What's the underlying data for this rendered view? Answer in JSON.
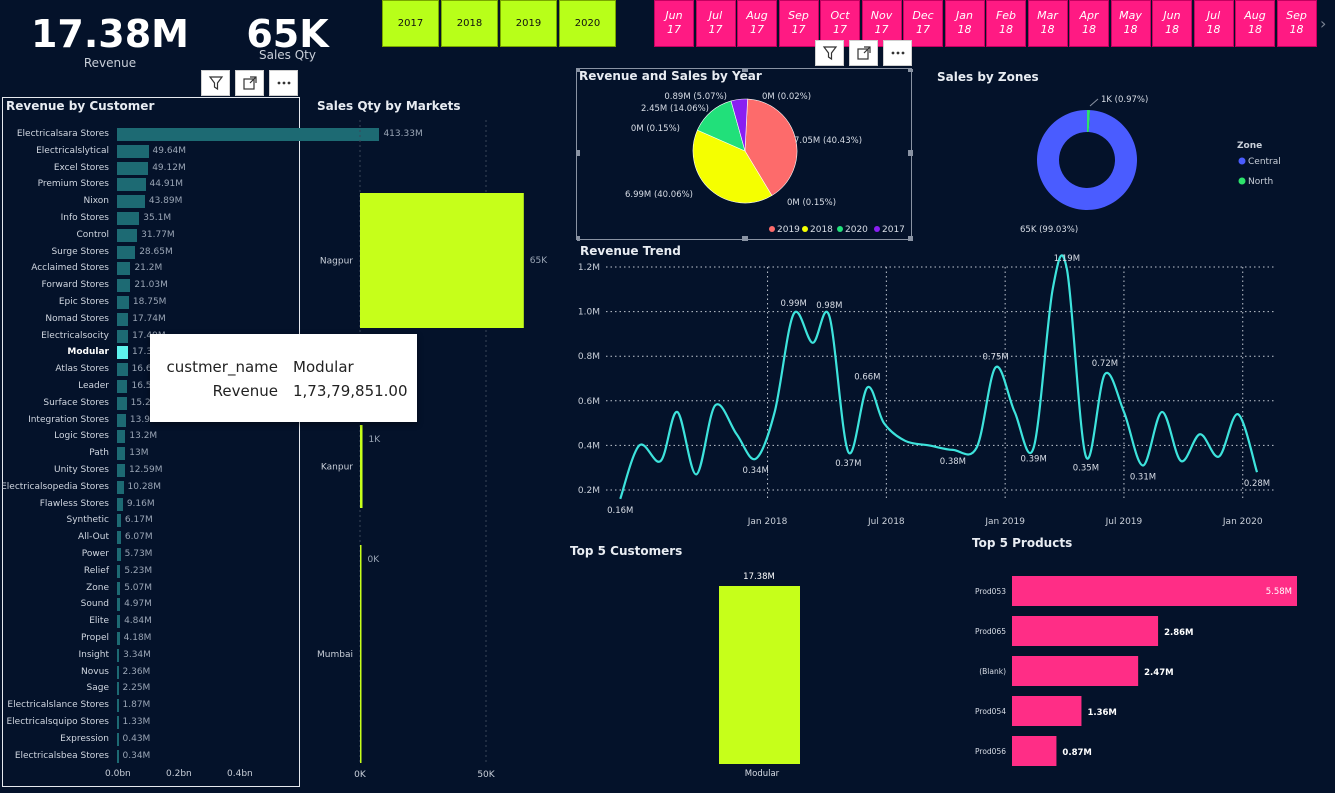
{
  "kpis": {
    "revenue_value": "17.38M",
    "revenue_label": "Revenue",
    "qty_value": "65K",
    "qty_label": "Sales Qty"
  },
  "year_slicer": [
    "2017",
    "2018",
    "2019",
    "2020"
  ],
  "month_slicer": [
    {
      "m": "Jun",
      "y": "17"
    },
    {
      "m": "Jul",
      "y": "17"
    },
    {
      "m": "Aug",
      "y": "17"
    },
    {
      "m": "Sep",
      "y": "17"
    },
    {
      "m": "Oct",
      "y": "17"
    },
    {
      "m": "Nov",
      "y": "17"
    },
    {
      "m": "Dec",
      "y": "17"
    },
    {
      "m": "Jan",
      "y": "18"
    },
    {
      "m": "Feb",
      "y": "18"
    },
    {
      "m": "Mar",
      "y": "18"
    },
    {
      "m": "Apr",
      "y": "18"
    },
    {
      "m": "May",
      "y": "18"
    },
    {
      "m": "Jun",
      "y": "18"
    },
    {
      "m": "Jul",
      "y": "18"
    },
    {
      "m": "Aug",
      "y": "18"
    },
    {
      "m": "Sep",
      "y": "18"
    }
  ],
  "colors": {
    "background": "#04122a",
    "lime": "#c6ff1a",
    "pink": "#ff2d86",
    "teal_bar": "#1d6a73",
    "line": "#3de3dc",
    "pie_2019": "#fd6b6b",
    "pie_2018": "#f5ff00",
    "pie_2020": "#21e07a",
    "pie_2017": "#8a1ff2",
    "zone_central": "#4a5cff",
    "zone_north": "#2de36b"
  },
  "icons": [
    "filter-icon",
    "focus-mode-icon",
    "more-options-icon",
    "chevron-right-icon"
  ],
  "chart_data": [
    {
      "id": "revenue_by_customer",
      "type": "bar",
      "title": "Revenue by Customer",
      "orientation": "horizontal",
      "categories": [
        "Electricalsara Stores",
        "Electricalslytical",
        "Excel Stores",
        "Premium Stores",
        "Nixon",
        "Info Stores",
        "Control",
        "Surge Stores",
        "Acclaimed Stores",
        "Forward Stores",
        "Epic Stores",
        "Nomad Stores",
        "Electricalsocity",
        "Modular",
        "Atlas Stores",
        "Leader",
        "Surface Stores",
        "Integration Stores",
        "Logic Stores",
        "Path",
        "Unity Stores",
        "Electricalsopedia Stores",
        "Flawless Stores",
        "Synthetic",
        "All-Out",
        "Power",
        "Relief",
        "Zone",
        "Sound",
        "Elite",
        "Propel",
        "Insight",
        "Novus",
        "Sage",
        "Electricalslance Stores",
        "Electricalsquipo Stores",
        "Expression",
        "Electricalsbea Stores"
      ],
      "values": [
        413.33,
        49.64,
        49.12,
        44.91,
        43.89,
        35.1,
        31.77,
        28.65,
        21.2,
        21.03,
        18.75,
        17.74,
        17.49,
        17.38,
        16.67,
        16.53,
        15.24,
        13.98,
        13.2,
        13,
        12.59,
        10.28,
        9.16,
        6.17,
        6.07,
        5.73,
        5.23,
        5.07,
        4.97,
        4.84,
        4.18,
        3.34,
        2.36,
        2.25,
        1.87,
        1.33,
        0.43,
        0.34
      ],
      "value_labels": [
        "413.33M",
        "49.64M",
        "49.12M",
        "44.91M",
        "43.89M",
        "35.1M",
        "31.77M",
        "28.65M",
        "21.2M",
        "21.03M",
        "18.75M",
        "17.74M",
        "17.49M",
        "17.38M",
        "16.67M",
        "16.53M",
        "15.24M",
        "13.98M",
        "13.2M",
        "13M",
        "12.59M",
        "10.28M",
        "9.16M",
        "6.17M",
        "6.07M",
        "5.73M",
        "5.23M",
        "5.07M",
        "4.97M",
        "4.84M",
        "4.18M",
        "3.34M",
        "2.36M",
        "2.25M",
        "1.87M",
        "1.33M",
        "0.43M",
        "0.34M"
      ],
      "highlight": "Modular",
      "x_ticks": [
        "0.0bn",
        "0.2bn",
        "0.4bn"
      ],
      "xlim": [
        0,
        0.45
      ]
    },
    {
      "id": "sales_qty_by_markets",
      "type": "bar",
      "title": "Sales Qty by Markets",
      "orientation": "horizontal",
      "categories": [
        "Nagpur",
        "Kanpur",
        "Mumbai"
      ],
      "values": [
        65000,
        1000,
        0
      ],
      "value_labels": [
        "65K",
        "1K",
        "0K"
      ],
      "x_ticks": [
        "0K",
        "50K"
      ],
      "xlim": [
        0,
        80000
      ]
    },
    {
      "id": "revenue_sales_by_year",
      "type": "pie",
      "title": "Revenue and Sales by Year",
      "slices": [
        {
          "name": "2019",
          "value": 7.05,
          "label": "7.05M (40.43%)"
        },
        {
          "name": "2019b",
          "value": 0.0,
          "label": "0M (0.15%)"
        },
        {
          "name": "2018",
          "value": 6.99,
          "label": "6.99M (40.06%)"
        },
        {
          "name": "2018b",
          "value": 0.0,
          "label": "0M (0.15%)"
        },
        {
          "name": "2020",
          "value": 2.45,
          "label": "2.45M (14.06%)"
        },
        {
          "name": "2017",
          "value": 0.89,
          "label": "0.89M (5.07%)"
        },
        {
          "name": "2017b",
          "value": 0.0,
          "label": "0M (0.02%)"
        }
      ],
      "legend": [
        "2019",
        "2018",
        "2020",
        "2017"
      ],
      "legend_position": "bottom-right"
    },
    {
      "id": "sales_by_zones",
      "type": "pie",
      "title": "Sales by Zones",
      "donut": true,
      "slices": [
        {
          "name": "Central",
          "value": 99.03,
          "label": "65K (99.03%)"
        },
        {
          "name": "North",
          "value": 0.97,
          "label": "1K (0.97%)"
        }
      ],
      "legend_title": "Zone",
      "legend": [
        "Central",
        "North"
      ],
      "legend_position": "right"
    },
    {
      "id": "revenue_trend",
      "type": "line",
      "title": "Revenue Trend",
      "y_ticks": [
        "0.2M",
        "0.4M",
        "0.6M",
        "0.8M",
        "1.0M",
        "1.2M"
      ],
      "ylim": [
        0.2,
        1.2
      ],
      "x_ticks": [
        "Jan 2018",
        "Jul 2018",
        "Jan 2019",
        "Jul 2019",
        "Jan 2020"
      ],
      "x_months": [
        0,
        6,
        12,
        18,
        24
      ],
      "points": [
        [
          -7,
          0.16
        ],
        [
          -6.2,
          0.4
        ],
        [
          -5.3,
          0.33
        ],
        [
          -4.6,
          0.55
        ],
        [
          -3.8,
          0.27
        ],
        [
          -3,
          0.58
        ],
        [
          -2.1,
          0.45
        ],
        [
          -1.3,
          0.34
        ],
        [
          -0.5,
          0.55
        ],
        [
          0.3,
          0.99
        ],
        [
          1.1,
          0.86
        ],
        [
          1.8,
          0.98
        ],
        [
          2.6,
          0.37
        ],
        [
          3.4,
          0.66
        ],
        [
          4.1,
          0.5
        ],
        [
          5,
          0.42
        ],
        [
          6,
          0.4
        ],
        [
          7,
          0.38
        ],
        [
          8,
          0.39
        ],
        [
          8.8,
          0.75
        ],
        [
          9.6,
          0.55
        ],
        [
          10.4,
          0.39
        ],
        [
          11.2,
          1.1
        ],
        [
          11.8,
          1.19
        ],
        [
          12.6,
          0.35
        ],
        [
          13.4,
          0.72
        ],
        [
          14.2,
          0.55
        ],
        [
          15,
          0.31
        ],
        [
          15.8,
          0.55
        ],
        [
          16.6,
          0.33
        ],
        [
          17.4,
          0.45
        ],
        [
          18.2,
          0.35
        ],
        [
          19,
          0.54
        ],
        [
          19.8,
          0.28
        ]
      ],
      "data_labels": [
        {
          "i": 0,
          "label": "0.16M"
        },
        {
          "i": 7,
          "label": "0.34M"
        },
        {
          "i": 9,
          "label": "0.99M"
        },
        {
          "i": 11,
          "label": "0.98M"
        },
        {
          "i": 12,
          "label": "0.37M"
        },
        {
          "i": 13,
          "label": "0.66M"
        },
        {
          "i": 17,
          "label": "0.38M"
        },
        {
          "i": 19,
          "label": "0.75M"
        },
        {
          "i": 21,
          "label": "0.39M"
        },
        {
          "i": 23,
          "label": "1.19M"
        },
        {
          "i": 24,
          "label": "0.35M"
        },
        {
          "i": 25,
          "label": "0.72M"
        },
        {
          "i": 27,
          "label": "0.31M"
        },
        {
          "i": 33,
          "label": "0.28M"
        }
      ]
    },
    {
      "id": "top5_customers",
      "type": "bar",
      "title": "Top 5 Customers",
      "categories": [
        "Modular"
      ],
      "values": [
        17.38
      ],
      "value_labels": [
        "17.38M"
      ]
    },
    {
      "id": "top5_products",
      "type": "bar",
      "title": "Top 5 Products",
      "orientation": "horizontal",
      "categories": [
        "Prod053",
        "Prod065",
        "(Blank)",
        "Prod054",
        "Prod056"
      ],
      "values": [
        5.58,
        2.86,
        2.47,
        1.36,
        0.87
      ],
      "value_labels": [
        "5.58M",
        "2.86M",
        "2.47M",
        "1.36M",
        "0.87M"
      ]
    }
  ],
  "tooltip": {
    "field1_name": "custmer_name",
    "field1_value": "Modular",
    "field2_name": "Revenue",
    "field2_value": "1,73,79,851.00"
  }
}
